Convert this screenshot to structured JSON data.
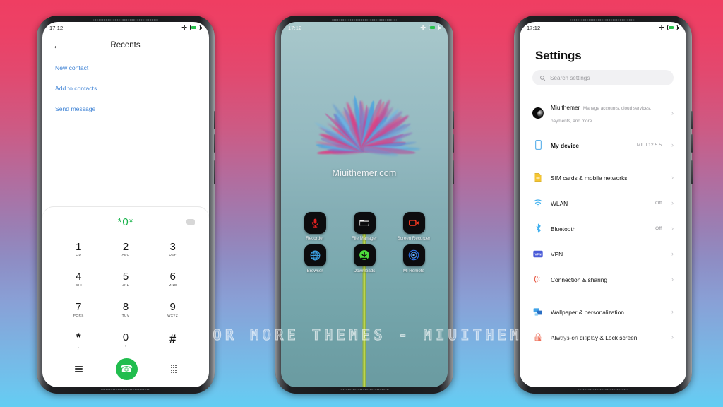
{
  "background": {
    "top_color": "#ef3e62",
    "bottom_color": "#63cdf3"
  },
  "watermark": {
    "text": "VISIT  FOR  MORE  THEMES  -  MIUITHEMER.COM"
  },
  "phone1": {
    "status": {
      "time": "17:12",
      "airplane_icon": "plus-icon",
      "battery_icon": "battery-icon"
    },
    "appbar": {
      "back_icon": "back-arrow-icon",
      "title": "Recents"
    },
    "links": [
      {
        "label": "New contact"
      },
      {
        "label": "Add to contacts"
      },
      {
        "label": "Send message"
      }
    ],
    "dialer": {
      "number": "*0*",
      "delete_icon": "backspace-icon",
      "accent_color": "#17b24a",
      "keys": [
        {
          "digit": "1",
          "letters": "QD"
        },
        {
          "digit": "2",
          "letters": "ABC"
        },
        {
          "digit": "3",
          "letters": "DEF"
        },
        {
          "digit": "4",
          "letters": "GHI"
        },
        {
          "digit": "5",
          "letters": "JKL"
        },
        {
          "digit": "6",
          "letters": "MNO"
        },
        {
          "digit": "7",
          "letters": "PQRS"
        },
        {
          "digit": "8",
          "letters": "TUV"
        },
        {
          "digit": "9",
          "letters": "WXYZ"
        },
        {
          "digit": "*",
          "letters": ","
        },
        {
          "digit": "0",
          "letters": "+"
        },
        {
          "digit": "#",
          "letters": ""
        }
      ],
      "bottom": {
        "menu_icon": "menu-icon",
        "call_icon": "phone-call-icon",
        "keypad_icon": "keypad-icon",
        "call_button_color": "#21bd4e"
      }
    }
  },
  "phone2": {
    "status": {
      "time": "17:12",
      "airplane_icon": "plus-icon",
      "battery_icon": "battery-icon"
    },
    "wallpaper_watermark": "Miuithemer.com",
    "apps": [
      [
        {
          "label": "Recorder",
          "icon": "microphone-icon",
          "color": "#e02020"
        },
        {
          "label": "File Manager",
          "icon": "folder-icon",
          "color": "#f2f2f2"
        },
        {
          "label": "Screen Recorder",
          "icon": "camcorder-icon",
          "color": "#ff3b20"
        }
      ],
      [
        {
          "label": "Browser",
          "icon": "globe-icon",
          "color": "#3c9de0"
        },
        {
          "label": "Downloads",
          "icon": "download-icon",
          "color": "#4ddc3b"
        },
        {
          "label": "Mi Remote",
          "icon": "remote-circle-icon",
          "color": "#2f7bff"
        }
      ]
    ]
  },
  "phone3": {
    "status": {
      "time": "17:12",
      "airplane_icon": "plus-icon",
      "battery_icon": "battery-icon"
    },
    "title": "Settings",
    "search": {
      "icon": "search-icon",
      "placeholder": "Search settings"
    },
    "account": {
      "name": "Miuithemer",
      "subtitle": "Manage accounts, cloud services, payments, and more",
      "avatar_icon": "avatar-icon",
      "chevron": "›"
    },
    "items": [
      {
        "label": "My device",
        "value": "MIUI 12.5.5",
        "icon": "device-icon",
        "bold": true,
        "chevron": "›"
      },
      {
        "label": "SIM cards & mobile networks",
        "value": "",
        "icon": "sim-card-icon",
        "bold": false,
        "chevron": "›"
      },
      {
        "label": "WLAN",
        "value": "Off",
        "icon": "wifi-icon",
        "bold": false,
        "chevron": "›"
      },
      {
        "label": "Bluetooth",
        "value": "Off",
        "icon": "bluetooth-icon",
        "bold": false,
        "chevron": "›"
      },
      {
        "label": "VPN",
        "value": "",
        "icon": "vpn-icon",
        "bold": false,
        "chevron": "›"
      },
      {
        "label": "Connection & sharing",
        "value": "",
        "icon": "connection-sharing-icon",
        "bold": false,
        "chevron": "›"
      },
      {
        "label": "Wallpaper & personalization",
        "value": "",
        "icon": "wallpaper-icon",
        "bold": false,
        "chevron": "›"
      },
      {
        "label": "Always-on display & Lock screen",
        "value": "",
        "icon": "lock-icon",
        "bold": false,
        "chevron": "›"
      }
    ]
  }
}
